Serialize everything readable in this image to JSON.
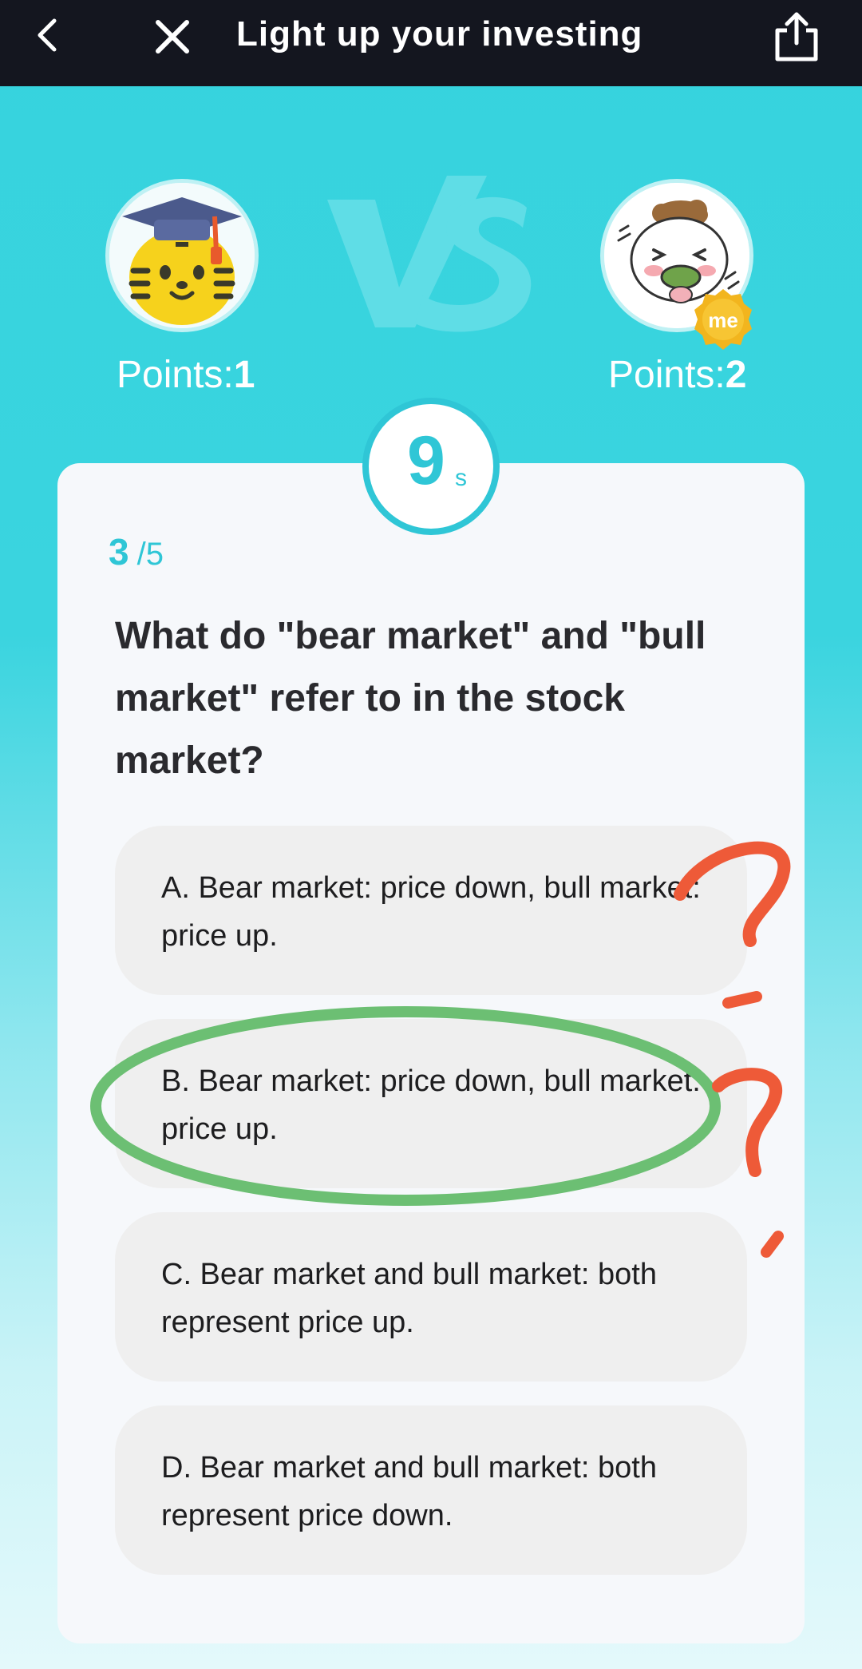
{
  "header": {
    "title": "Light up your investing",
    "back_icon": "chevron-left-icon",
    "close_icon": "close-icon",
    "share_icon": "share-icon"
  },
  "battle": {
    "opponent": {
      "points_label": "Points:",
      "points": "1",
      "avatar": "tiger-graduate-avatar"
    },
    "player": {
      "points_label": "Points:",
      "points": "2",
      "avatar": "cartoon-avatar",
      "badge": "me"
    },
    "vs_mark": "vs-logo"
  },
  "timer": {
    "value": "9",
    "unit": "s"
  },
  "progress": {
    "current": "3",
    "total": "/5"
  },
  "question": "What do \"bear market\" and \"bull market\" refer to in the stock market?",
  "options": [
    {
      "label": "A. Bear market: price down, bull market: price up."
    },
    {
      "label": "B. Bear market: price down, bull market: price up."
    },
    {
      "label": "C. Bear market and bull market: both represent price up."
    },
    {
      "label": "D. Bear market and bull market: both represent price down."
    }
  ],
  "colors": {
    "accent": "#2fc6d6",
    "header_bg": "#14161f",
    "annotation_green": "#6cbf73",
    "annotation_red": "#ee5a38"
  }
}
